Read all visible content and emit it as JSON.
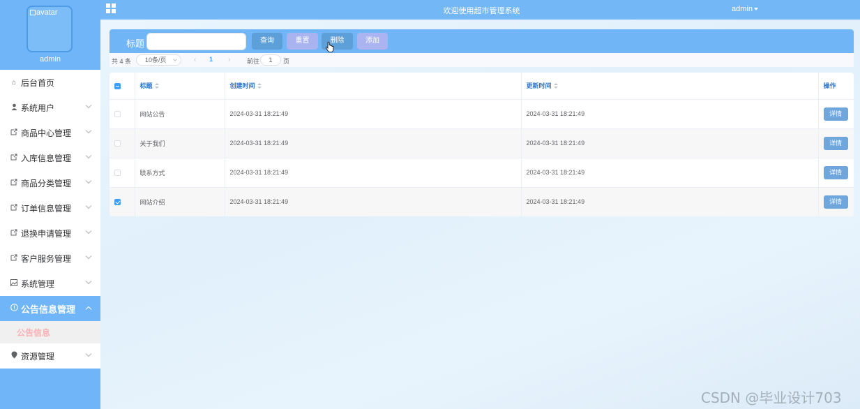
{
  "topbar": {
    "title": "欢迎使用超市管理系统",
    "user": "admin"
  },
  "sidebar": {
    "avatar_alt": "avatar",
    "username": "admin",
    "items": [
      {
        "label": "后台首页",
        "icon": "home-icon",
        "glyph": "⌂",
        "has_children": false
      },
      {
        "label": "系统用户",
        "icon": "user-icon",
        "glyph": "👤",
        "has_children": true
      },
      {
        "label": "商品中心管理",
        "icon": "share-icon",
        "glyph": "⇱",
        "has_children": true
      },
      {
        "label": "入库信息管理",
        "icon": "share-icon",
        "glyph": "⇱",
        "has_children": true
      },
      {
        "label": "商品分类管理",
        "icon": "share-icon",
        "glyph": "⇱",
        "has_children": true
      },
      {
        "label": "订单信息管理",
        "icon": "share-icon",
        "glyph": "⇱",
        "has_children": true
      },
      {
        "label": "退换申请管理",
        "icon": "share-icon",
        "glyph": "⇱",
        "has_children": true
      },
      {
        "label": "客户服务管理",
        "icon": "share-icon",
        "glyph": "⇱",
        "has_children": true
      },
      {
        "label": "系统管理",
        "icon": "picture-icon",
        "glyph": "▣",
        "has_children": true
      },
      {
        "label": "公告信息管理",
        "icon": "info-icon",
        "glyph": "ⓘ",
        "has_children": true,
        "active": true
      },
      {
        "label": "资源管理",
        "icon": "location-icon",
        "glyph": "●",
        "has_children": true
      }
    ],
    "submenu_label": "公告信息"
  },
  "search": {
    "label": "标题",
    "placeholder": "",
    "value": "",
    "query_label": "查询",
    "reset_label": "重置",
    "delete_label": "删除",
    "add_label": "添加"
  },
  "pager": {
    "total": "共 4 条",
    "page_size": "10条/页",
    "current": "1",
    "goto_label": "前往",
    "goto_value": "1",
    "page_suffix": "页"
  },
  "table": {
    "headers": {
      "title": "标题",
      "created": "创建时间",
      "updated": "更新时间",
      "actions": "操作"
    },
    "detail_label": "详情",
    "rows": [
      {
        "title": "网站公告",
        "created": "2024-03-31 18:21:49",
        "updated": "2024-03-31 18:21:49",
        "checked": false
      },
      {
        "title": "关于我们",
        "created": "2024-03-31 18:21:49",
        "updated": "2024-03-31 18:21:49",
        "checked": false
      },
      {
        "title": "联系方式",
        "created": "2024-03-31 18:21:49",
        "updated": "2024-03-31 18:21:49",
        "checked": false
      },
      {
        "title": "网站介绍",
        "created": "2024-03-31 18:21:49",
        "updated": "2024-03-31 18:21:49",
        "checked": true
      }
    ]
  },
  "watermark": "CSDN @毕业设计703",
  "colors": {
    "sidebar": "#6fb5f7",
    "topbar": "#73b7f7",
    "primary": "#409eff",
    "submenu_text": "#f9b3b7"
  }
}
